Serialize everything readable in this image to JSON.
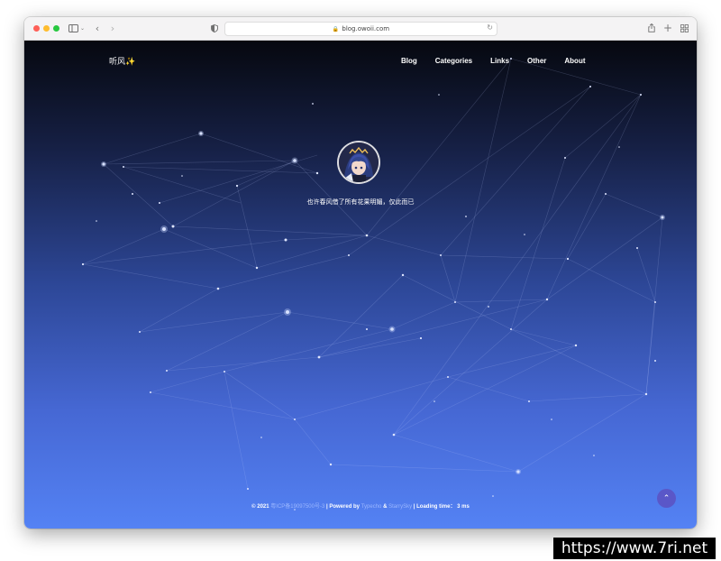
{
  "browser": {
    "url": "blog.owoii.com"
  },
  "site": {
    "brand": "听风✨",
    "nav": [
      "Blog",
      "Categories",
      "Links",
      "Other",
      "About"
    ],
    "motto": "也许春风借了所有花果明媚，仅此而已"
  },
  "footer": {
    "copyright": "© 2021",
    "icp": "粤ICP备19097500号-3",
    "sep1": "| Powered by",
    "typecho": "Typecho",
    "amp": "&",
    "theme": "StarrySky",
    "loading": "| Loading time：",
    "time": "3 ms"
  },
  "watermark": "https://www.7ri.net"
}
